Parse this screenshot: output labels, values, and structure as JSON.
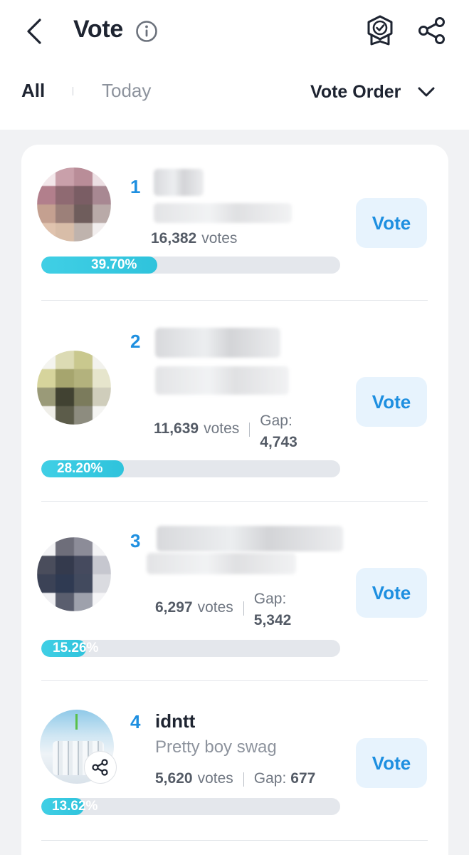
{
  "header": {
    "title": "Vote",
    "tabs": {
      "all": "All",
      "today": "Today"
    },
    "sort_label": "Vote Order"
  },
  "entries": [
    {
      "rank": "1",
      "votes": "16,382",
      "votes_suffix": "votes",
      "percent_label": "39.70%",
      "percent": 39.7,
      "vote_label": "Vote"
    },
    {
      "rank": "2",
      "votes": "11,639",
      "votes_suffix": "votes",
      "gap_label": "Gap:",
      "gap": "4,743",
      "percent_label": "28.20%",
      "percent": 28.2,
      "vote_label": "Vote"
    },
    {
      "rank": "3",
      "votes": "6,297",
      "votes_suffix": "votes",
      "gap_label": "Gap:",
      "gap": "5,342",
      "percent_label": "15.26%",
      "percent": 15.26,
      "vote_label": "Vote"
    },
    {
      "rank": "4",
      "name": "idntt",
      "subtitle": "Pretty boy swag",
      "votes": "5,620",
      "votes_suffix": "votes",
      "gap_label": "Gap:",
      "gap": "677",
      "percent_label": "13.62%",
      "percent": 13.62,
      "vote_label": "Vote"
    }
  ],
  "colors": {
    "accent": "#1e8fe0",
    "bar_fill": "#36c8e0",
    "bar_track": "#e4e7ec",
    "vote_button_bg": "#e7f3fd"
  },
  "icons": [
    "back-arrow-icon",
    "info-icon",
    "badge-check-icon",
    "share-icon",
    "chevron-down-icon"
  ]
}
